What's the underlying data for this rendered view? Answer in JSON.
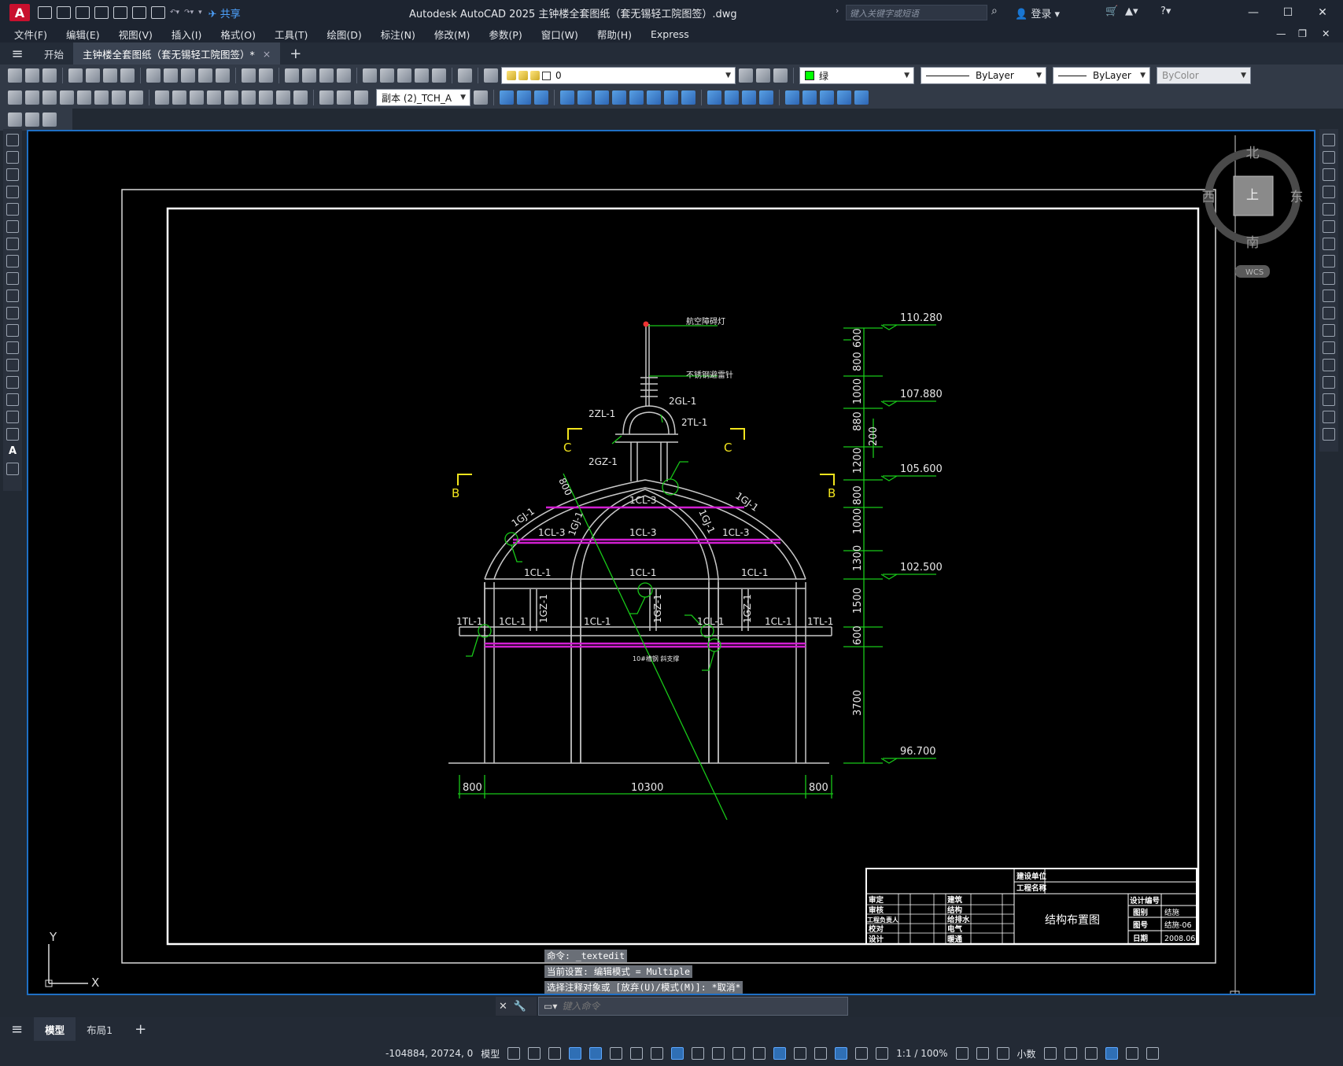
{
  "app": {
    "logo_letter": "A",
    "title": "Autodesk AutoCAD 2025    主钟楼全套图纸（套无锡轻工院图签）.dwg",
    "share_label": "共享",
    "search_placeholder": "键入关键字或短语",
    "login_label": "登录"
  },
  "menu": [
    "文件(F)",
    "编辑(E)",
    "视图(V)",
    "插入(I)",
    "格式(O)",
    "工具(T)",
    "绘图(D)",
    "标注(N)",
    "修改(M)",
    "参数(P)",
    "窗口(W)",
    "帮助(H)",
    "Express"
  ],
  "tabs": {
    "start": "开始",
    "document": "主钟楼全套图纸（套无锡轻工院图签）*",
    "close": "×",
    "add": "+"
  },
  "properties": {
    "layer": "0",
    "color": "绿",
    "linetype": "ByLayer",
    "lineweight": "ByLayer",
    "plotstyle": "ByColor",
    "dimstyle": "副本 (2)_TCH_A"
  },
  "viewcube": {
    "north": "北",
    "south": "南",
    "east": "东",
    "west": "西",
    "top": "上",
    "wcs": "WCS"
  },
  "ucs": {
    "x": "X",
    "y": "Y"
  },
  "drawing": {
    "labels_steel": [
      "2ZL-1",
      "2GL-1",
      "2TL-1",
      "2GZ-1",
      "1CL-3",
      "1CL-3",
      "1CL-3",
      "1CL-3",
      "1GJ-1",
      "1GJ-1",
      "1GJ-1",
      "1GJ-1",
      "1CL-1",
      "1CL-1",
      "1CL-1",
      "1CL-1",
      "1CL-1",
      "1CL-1",
      "1CL-1",
      "1GZ-1",
      "1GZ-1",
      "1GZ-1",
      "1TL-1",
      "1TL-1"
    ],
    "annot_top": "航空障碍灯",
    "annot_mid": "不锈钢避雷针",
    "annot_low": "10#槽钢 斜支撑",
    "section_marks": [
      "C",
      "C",
      "B",
      "B"
    ],
    "elevations": [
      "110.280",
      "107.880",
      "105.600",
      "102.500",
      "96.700"
    ],
    "vdims": [
      "600",
      "800",
      "1000",
      "880",
      "1200",
      "800",
      "1000",
      "1300",
      "1500",
      "600",
      "3700"
    ],
    "vdim_side": "200",
    "diag_dim": "800",
    "hdims": [
      "800",
      "10300",
      "800"
    ]
  },
  "titleblock": {
    "build_unit": "建设单位",
    "project_name": "工程名称",
    "left_rows": [
      "审定",
      "审核",
      "工程负责人",
      "校对",
      "设计"
    ],
    "right_rows": [
      "建筑",
      "结构",
      "给排水",
      "电气",
      "暖通"
    ],
    "drawing_title": "结构布置图",
    "design_no_label": "设计编号",
    "kind_label": "图别",
    "kind_value": "结施",
    "no_label": "图号",
    "no_value": "结施-06",
    "date_label": "日期",
    "date_value": "2008.06"
  },
  "command": {
    "history": [
      "命令: _textedit",
      "当前设置: 编辑模式 = Multiple",
      "选择注释对象或 [放弃(U)/模式(M)]: *取消*"
    ],
    "placeholder": "键入命令"
  },
  "layouts": {
    "model": "模型",
    "layout1": "布局1",
    "add": "+"
  },
  "status": {
    "coords": "-104884, 20724, 0",
    "space": "模型",
    "scale": "1:1 / 100%",
    "units": "小数"
  }
}
